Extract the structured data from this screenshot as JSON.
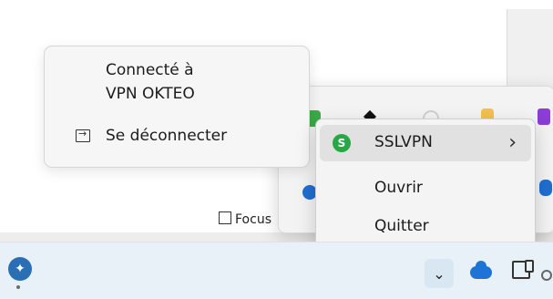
{
  "vpn_popup": {
    "status_line1": "Connecté à",
    "status_line2": "VPN OKTEO",
    "disconnect_label": "Se déconnecter"
  },
  "context_menu": {
    "items": [
      {
        "label": "SSLVPN",
        "has_submenu": true,
        "icon": "sslvpn-icon",
        "selected": true
      },
      {
        "label": "Ouvrir",
        "has_submenu": false
      },
      {
        "label": "Quitter",
        "has_submenu": false
      }
    ]
  },
  "tray_flyout": {
    "focus_label": "Focus"
  },
  "taskbar": {
    "overflow_chevron": "⌄"
  },
  "colors": {
    "taskbar_bg": "#e7f1f7",
    "accent": "#29a745",
    "menu_selected": "#e1e1e1",
    "cloud": "#1e74d6"
  },
  "icons": [
    "network-icon",
    "sslvpn-icon",
    "disconnect-icon",
    "chevron-right-icon",
    "cloud-icon",
    "device-icon",
    "focus-icon"
  ]
}
